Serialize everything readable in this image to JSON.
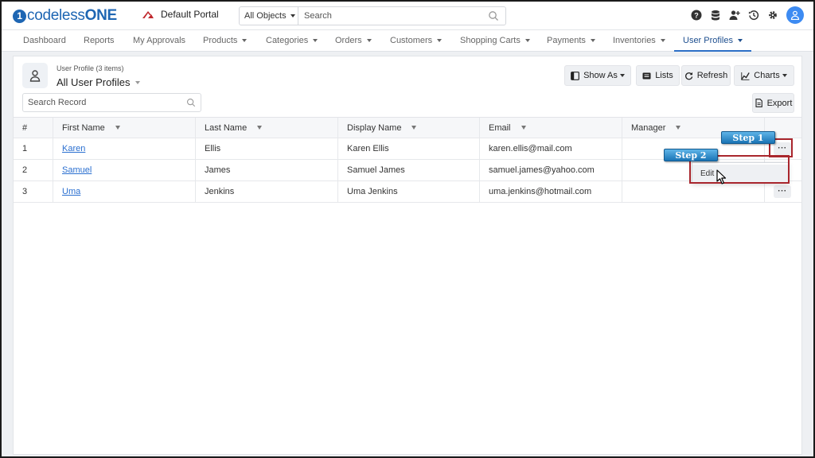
{
  "app": {
    "brand": "codelessONE",
    "brand_a": "codeless",
    "brand_b": "ONE",
    "portal": "Default Portal"
  },
  "search": {
    "scope": "All Objects",
    "placeholder": "Search"
  },
  "nav": {
    "items": [
      {
        "label": "Dashboard"
      },
      {
        "label": "Reports"
      },
      {
        "label": "My Approvals"
      },
      {
        "label": "Products"
      },
      {
        "label": "Categories"
      },
      {
        "label": "Orders"
      },
      {
        "label": "Customers"
      },
      {
        "label": "Shopping Carts"
      },
      {
        "label": "Payments"
      },
      {
        "label": "Inventories"
      },
      {
        "label": "User Profiles"
      }
    ],
    "active": "User Profiles"
  },
  "page": {
    "subtitle": "User Profile (3 items)",
    "title": "All User Profiles",
    "search_placeholder": "Search Record",
    "buttons": {
      "show_as": "Show As",
      "lists": "Lists",
      "refresh": "Refresh",
      "charts": "Charts",
      "export": "Export"
    }
  },
  "table": {
    "columns": [
      "#",
      "First Name",
      "Last Name",
      "Display Name",
      "Email",
      "Manager"
    ],
    "rows": [
      {
        "num": "1",
        "first": "Karen",
        "last": "Ellis",
        "display": "Karen Ellis",
        "email": "karen.ellis@mail.com",
        "manager": ""
      },
      {
        "num": "2",
        "first": "Samuel",
        "last": "James",
        "display": "Samuel James",
        "email": "samuel.james@yahoo.com",
        "manager": ""
      },
      {
        "num": "3",
        "first": "Uma",
        "last": "Jenkins",
        "display": "Uma Jenkins",
        "email": "uma.jenkins@hotmail.com",
        "manager": ""
      }
    ],
    "row_action": "···"
  },
  "overlay": {
    "step1": "Step 1",
    "step2": "Step 2",
    "menu_edit": "Edit"
  },
  "colors": {
    "brand": "#1e66b3",
    "link": "#2a6fd0",
    "active_tab": "#2c6fc7",
    "highlight": "#a9262d",
    "step_badge": "#1a74b5"
  }
}
